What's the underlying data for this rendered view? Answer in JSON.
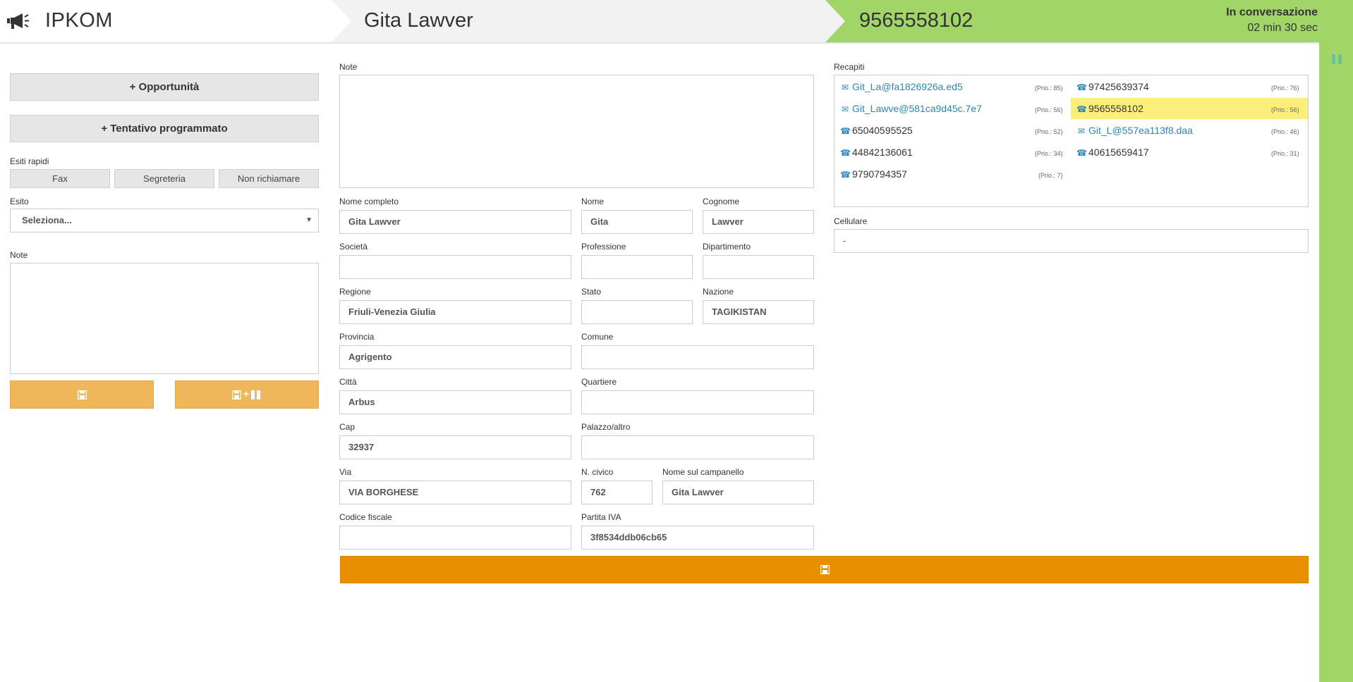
{
  "header": {
    "app_name": "IPKOM",
    "caller_name": "Gita Lawver",
    "caller_number": "9565558102",
    "call_status": "In conversazione",
    "call_timer": "02 min 30 sec",
    "colors": {
      "status_green": "#a1d568",
      "header_gray": "#f2f2f2"
    }
  },
  "left_panel": {
    "opportunity_button": "+ Opportunità",
    "scheduled_attempt_button": "+ Tentativo programmato",
    "quick_outcomes_label": "Esiti rapidi",
    "quick_outcomes": [
      "Fax",
      "Segreteria",
      "Non richiamare"
    ],
    "outcome_label": "Esito",
    "outcome_select_value": "Seleziona...",
    "notes_label": "Note",
    "save_icon": "save-icon",
    "save_pause_icon": "save-plus-pause-icon",
    "save_pause_plus": "+"
  },
  "form": {
    "notes_label": "Note",
    "fields": {
      "nome_completo": {
        "label": "Nome completo",
        "value": "Gita Lawver"
      },
      "nome": {
        "label": "Nome",
        "value": "Gita"
      },
      "cognome": {
        "label": "Cognome",
        "value": "Lawver"
      },
      "societa": {
        "label": "Società",
        "value": ""
      },
      "professione": {
        "label": "Professione",
        "value": ""
      },
      "dipartimento": {
        "label": "Dipartimento",
        "value": ""
      },
      "regione": {
        "label": "Regione",
        "value": "Friuli-Venezia Giulia"
      },
      "stato": {
        "label": "Stato",
        "value": ""
      },
      "nazione": {
        "label": "Nazione",
        "value": "TAGIKISTAN"
      },
      "provincia": {
        "label": "Provincia",
        "value": "Agrigento"
      },
      "comune": {
        "label": "Comune",
        "value": ""
      },
      "citta": {
        "label": "Città",
        "value": "Arbus"
      },
      "quartiere": {
        "label": "Quartiere",
        "value": ""
      },
      "cap": {
        "label": "Cap",
        "value": "32937"
      },
      "palazzo": {
        "label": "Palazzo/altro",
        "value": ""
      },
      "via": {
        "label": "Via",
        "value": "VIA BORGHESE"
      },
      "civico": {
        "label": "N. civico",
        "value": "762"
      },
      "campanello": {
        "label": "Nome sul campanello",
        "value": "Gita Lawver"
      },
      "codice_fiscale": {
        "label": "Codice fiscale",
        "value": ""
      },
      "partita_iva": {
        "label": "Partita IVA",
        "value": "3f8534ddb06cb65"
      }
    },
    "save_icon": "save-icon"
  },
  "contacts": {
    "label": "Recapiti",
    "items": [
      {
        "type": "email",
        "value": "Git_La@fa1826926a.ed5",
        "prio": "(Prio.: 85)"
      },
      {
        "type": "email",
        "value": "Git_Lawve@581ca9d45c.7e7",
        "prio": "(Prio.: 56)"
      },
      {
        "type": "phone",
        "value": "65040595525",
        "prio": "(Prio.: 52)"
      },
      {
        "type": "phone",
        "value": "44842136061",
        "prio": "(Prio.: 34)"
      },
      {
        "type": "phone",
        "value": "9790794357",
        "prio": "(Prio.: 7)"
      },
      {
        "type": "phone",
        "value": "97425639374",
        "prio": "(Prio.: 76)"
      },
      {
        "type": "phone",
        "value": "9565558102",
        "prio": "(Prio.: 56)",
        "highlighted": true
      },
      {
        "type": "email",
        "value": "Git_L@557ea113f8.daa",
        "prio": "(Prio.: 46)"
      },
      {
        "type": "phone",
        "value": "40615659417",
        "prio": "(Prio.: 31)"
      }
    ],
    "highlight_color": "#fcee7a",
    "mobile_label": "Cellulare",
    "mobile_value": "-"
  }
}
